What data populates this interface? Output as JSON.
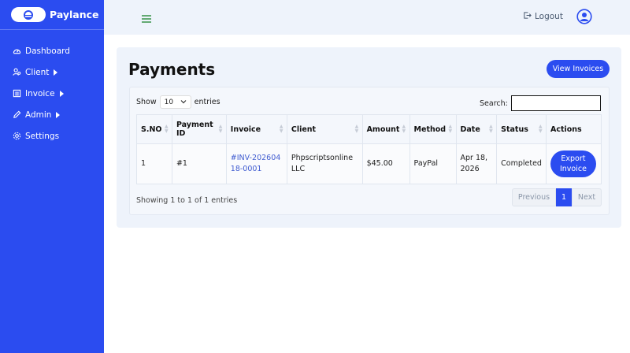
{
  "brand": {
    "name": "Paylance"
  },
  "sidebar": {
    "items": [
      {
        "label": "Dashboard",
        "icon": "gauge-icon",
        "has_caret": false
      },
      {
        "label": "Client",
        "icon": "users-icon",
        "has_caret": true
      },
      {
        "label": "Invoice",
        "icon": "invoice-icon",
        "has_caret": true
      },
      {
        "label": "Admin",
        "icon": "pen-icon",
        "has_caret": true
      },
      {
        "label": "Settings",
        "icon": "gear-icon",
        "has_caret": false
      }
    ]
  },
  "topbar": {
    "logout_label": "Logout"
  },
  "main": {
    "title": "Payments",
    "view_invoices_label": "View Invoices",
    "length": {
      "prefix": "Show",
      "value": "10",
      "suffix": "entries"
    },
    "search": {
      "label": "Search:",
      "value": ""
    },
    "table": {
      "headers": [
        "S.NO",
        "Payment ID",
        "Invoice",
        "Client",
        "Amount",
        "Method",
        "Date",
        "Status",
        "Actions"
      ],
      "rows": [
        {
          "sno": "1",
          "payment_id": "#1",
          "invoice": "#INV-20260418-0001",
          "client": "Phpscriptsonline LLC",
          "amount": "$45.00",
          "method": "PayPal",
          "date": "Apr 18, 2026",
          "status": "Completed",
          "action_label": "Export Invoice"
        }
      ]
    },
    "info": "Showing 1 to 1 of 1 entries",
    "pagination": {
      "previous": "Previous",
      "current": "1",
      "next": "Next"
    }
  },
  "colors": {
    "primary": "#2b4cf0",
    "panel": "#eef3fb",
    "link": "#3f5bd0"
  }
}
